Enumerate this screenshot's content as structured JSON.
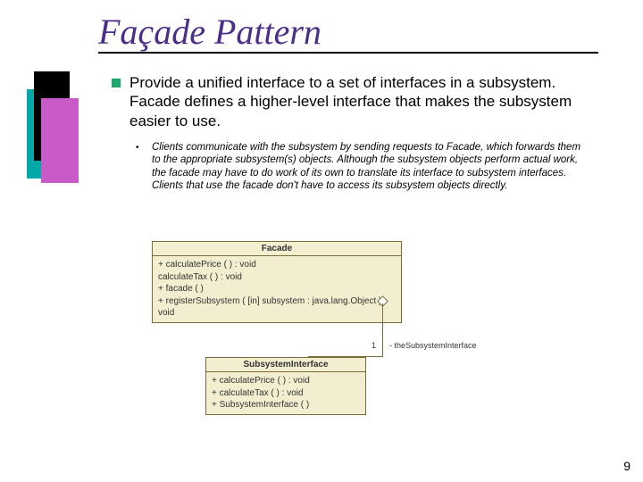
{
  "title": "Façade Pattern",
  "main": "Provide a unified interface to a set of interfaces in a subsystem. Facade defines a higher-level interface that makes the subsystem easier to use.",
  "sub": "Clients communicate with the subsystem by sending requests to Facade, which forwards them to the appropriate subsystem(s) objects. Although the subsystem objects perform actual work, the facade may have to do work of its own to translate its interface to subsystem interfaces.  Clients that use the facade don't have to access its subsystem objects directly.",
  "uml": {
    "facade": {
      "name": "Facade",
      "ops": "+ calculatePrice ( ) : void\n  calculateTax ( ) : void\n+ facade ( )\n+ registerSubsystem ( [in] subsystem : java.lang.Object ) : void"
    },
    "subsystem": {
      "name": "SubsystemInterface",
      "ops": "+ calculatePrice ( ) : void\n+ calculateTax ( ) : void\n+ SubsystemInterface ( )"
    },
    "assoc_label": "- theSubsystemInterface",
    "assoc_mult": "1"
  },
  "page": "9"
}
